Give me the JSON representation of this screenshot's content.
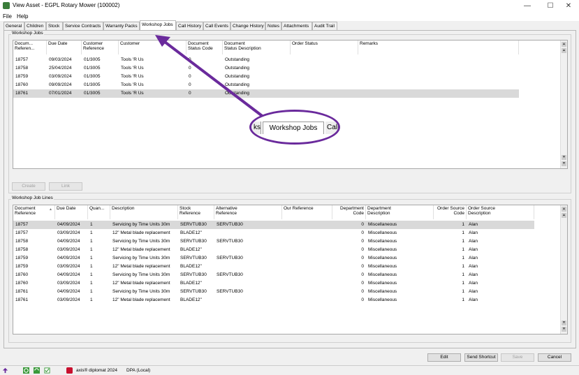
{
  "window": {
    "title": "View Asset - EGPL Rotary Mower (100002)",
    "minimize": "—",
    "maximize": "☐",
    "close": "✕"
  },
  "menu": [
    "File",
    "Help"
  ],
  "tabs": [
    "General",
    "Children",
    "Stock",
    "Service Contracts",
    "Warranty Packs",
    "Workshop Jobs",
    "Call History",
    "Call Events",
    "Change History",
    "Notes",
    "Attachments",
    "Audit Trail"
  ],
  "active_tab": "Workshop Jobs",
  "jobs": {
    "group_label": "Workshop Jobs",
    "columns": [
      "Docum...\nReferen...",
      "Due Date",
      "Customer\nReference",
      "Customer",
      "Document\nStatus Code",
      "Document\nStatus Description",
      "Order Status",
      "Remarks"
    ],
    "rows": [
      [
        "18757",
        "09/03/2024",
        "01/3005",
        "Tools 'R Us",
        "0",
        "Outstanding",
        "",
        ""
      ],
      [
        "18758",
        "25/04/2024",
        "01/3005",
        "Tools 'R Us",
        "0",
        "Outstanding",
        "",
        ""
      ],
      [
        "18759",
        "03/09/2024",
        "01/3005",
        "Tools 'R Us",
        "0",
        "Outstanding",
        "",
        ""
      ],
      [
        "18760",
        "09/09/2024",
        "01/3005",
        "Tools 'R Us",
        "0",
        "Outstanding",
        "",
        ""
      ],
      [
        "18761",
        "07/01/2024",
        "01/3005",
        "Tools 'R Us",
        "0",
        "Outstanding",
        "",
        ""
      ]
    ],
    "selected_row": 4,
    "create_label": "Create",
    "link_label": "Link"
  },
  "lines": {
    "group_label": "Workshop Job Lines",
    "columns": [
      "Document\nReference",
      "Due Date",
      "Quan...",
      "Description",
      "Stock\nReference",
      "Alternative\nReference",
      "Our Reference",
      "Department\nCode",
      "Department\nDescription",
      "Order Source\nCode",
      "Order Source\nDescription"
    ],
    "rows": [
      [
        "18757",
        "04/09/2024",
        "1",
        "Servicing by Time Units 30m",
        "SERVTUB30",
        "SERVTUB30",
        "",
        "0",
        "Miscellaneous",
        "1",
        "Alan"
      ],
      [
        "18757",
        "03/09/2024",
        "1",
        "12\" Metal blade replacement",
        "BLADE12\"",
        "",
        "",
        "0",
        "Miscellaneous",
        "1",
        "Alan"
      ],
      [
        "18758",
        "04/09/2024",
        "1",
        "Servicing by Time Units 30m",
        "SERVTUB30",
        "SERVTUB30",
        "",
        "0",
        "Miscellaneous",
        "1",
        "Alan"
      ],
      [
        "18758",
        "03/09/2024",
        "1",
        "12\" Metal blade replacement",
        "BLADE12\"",
        "",
        "",
        "0",
        "Miscellaneous",
        "1",
        "Alan"
      ],
      [
        "18759",
        "04/09/2024",
        "1",
        "Servicing by Time Units 30m",
        "SERVTUB30",
        "SERVTUB30",
        "",
        "0",
        "Miscellaneous",
        "1",
        "Alan"
      ],
      [
        "18759",
        "03/09/2024",
        "1",
        "12\" Metal blade replacement",
        "BLADE12\"",
        "",
        "",
        "0",
        "Miscellaneous",
        "1",
        "Alan"
      ],
      [
        "18760",
        "04/09/2024",
        "1",
        "Servicing by Time Units 30m",
        "SERVTUB30",
        "SERVTUB30",
        "",
        "0",
        "Miscellaneous",
        "1",
        "Alan"
      ],
      [
        "18760",
        "03/09/2024",
        "1",
        "12\" Metal blade replacement",
        "BLADE12\"",
        "",
        "",
        "0",
        "Miscellaneous",
        "1",
        "Alan"
      ],
      [
        "18761",
        "04/09/2024",
        "1",
        "Servicing by Time Units 30m",
        "SERVTUB30",
        "SERVTUB30",
        "",
        "0",
        "Miscellaneous",
        "1",
        "Alan"
      ],
      [
        "18761",
        "03/09/2024",
        "1",
        "12\" Metal blade replacement",
        "BLADE12\"",
        "",
        "",
        "0",
        "Miscellaneous",
        "1",
        "Alan"
      ]
    ],
    "selected_row": 0
  },
  "footer_buttons": {
    "edit": "Edit",
    "send_shortcut": "Send Shortcut",
    "save": "Save",
    "cancel": "Cancel"
  },
  "status": {
    "product": "axis® diplomat 2024",
    "db": "DPA (Local)"
  },
  "callout": {
    "left_fragment": "ks",
    "center": "Workshop Jobs",
    "right_fragment": "Call"
  },
  "colors": {
    "accent": "#6a2a9c",
    "selected_row": "#d9d9d9"
  }
}
